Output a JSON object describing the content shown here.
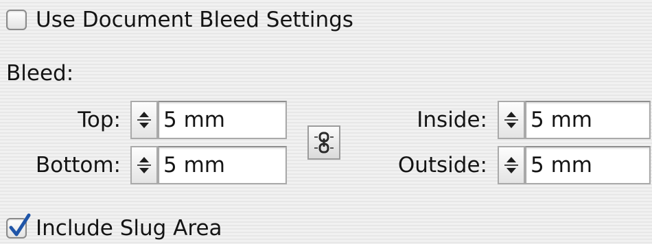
{
  "bleed_settings": {
    "use_document_bleed": {
      "label": "Use Document Bleed Settings",
      "checked": false
    },
    "section_label": "Bleed:",
    "fields": {
      "top": {
        "label": "Top:",
        "value": "5 mm"
      },
      "bottom": {
        "label": "Bottom:",
        "value": "5 mm"
      },
      "inside": {
        "label": "Inside:",
        "value": "5 mm"
      },
      "outside": {
        "label": "Outside:",
        "value": "5 mm"
      }
    },
    "link_button_icon": "chain-link-icon",
    "stepper_icon": "up-down-arrows-icon"
  },
  "include_slug_area": {
    "label": "Include Slug Area",
    "checked": true
  },
  "colors": {
    "checkmark": "#1f55a8",
    "panel_background": "#eeeeee",
    "text": "#141414"
  }
}
